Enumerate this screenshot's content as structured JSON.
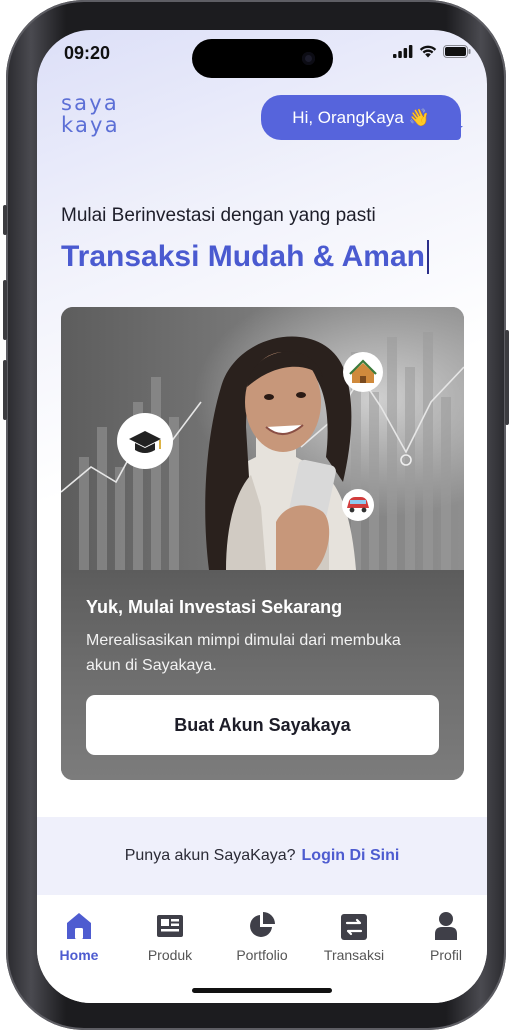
{
  "status_bar": {
    "time": "09:20"
  },
  "header": {
    "logo_line1": "saya",
    "logo_line2": "kaya",
    "greeting": "Hi, OrangKaya 👋"
  },
  "hero": {
    "subtitle": "Mulai Berinvestasi dengan yang pasti",
    "headline": "Transaksi Mudah & Aman"
  },
  "promo_card": {
    "title": "Yuk, Mulai Investasi Sekarang",
    "description": "Merealisasikan mimpi dimulai dari membuka akun di Sayakaya.",
    "button_label": "Buat Akun Sayakaya",
    "badges": [
      "graduation-cap-icon",
      "house-icon",
      "car-icon"
    ]
  },
  "login_prompt": {
    "question": "Punya akun SayaKaya?",
    "link": "Login Di Sini"
  },
  "bottom_nav": {
    "items": [
      {
        "label": "Home",
        "icon": "home-icon",
        "active": true
      },
      {
        "label": "Produk",
        "icon": "product-icon",
        "active": false
      },
      {
        "label": "Portfolio",
        "icon": "pie-chart-icon",
        "active": false
      },
      {
        "label": "Transaksi",
        "icon": "transfer-icon",
        "active": false
      },
      {
        "label": "Profil",
        "icon": "user-icon",
        "active": false
      }
    ]
  },
  "colors": {
    "accent": "#5664dc",
    "accent_text": "#4a5ad0",
    "card_body": "#6b6b6b",
    "login_bar_bg": "#eff0fb"
  }
}
